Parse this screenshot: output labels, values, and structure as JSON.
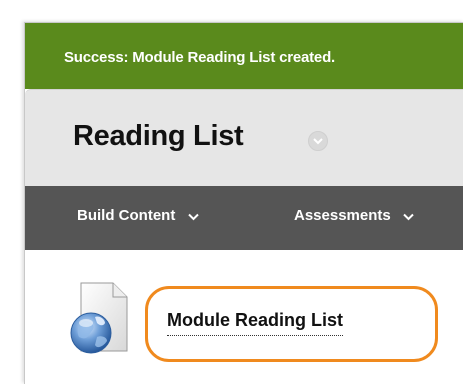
{
  "banner": {
    "message": "Success: Module Reading List created."
  },
  "page": {
    "title": "Reading List"
  },
  "menu": {
    "items": [
      {
        "label": "Build Content"
      },
      {
        "label": "Assessments"
      }
    ]
  },
  "content": {
    "items": [
      {
        "label": "Module Reading List",
        "icon": "web-link-globe-icon"
      }
    ]
  },
  "colors": {
    "success": "#5a8a1c",
    "menu_bar": "#555555",
    "title_bar": "#e6e6e6",
    "highlight": "#f08a1e"
  }
}
